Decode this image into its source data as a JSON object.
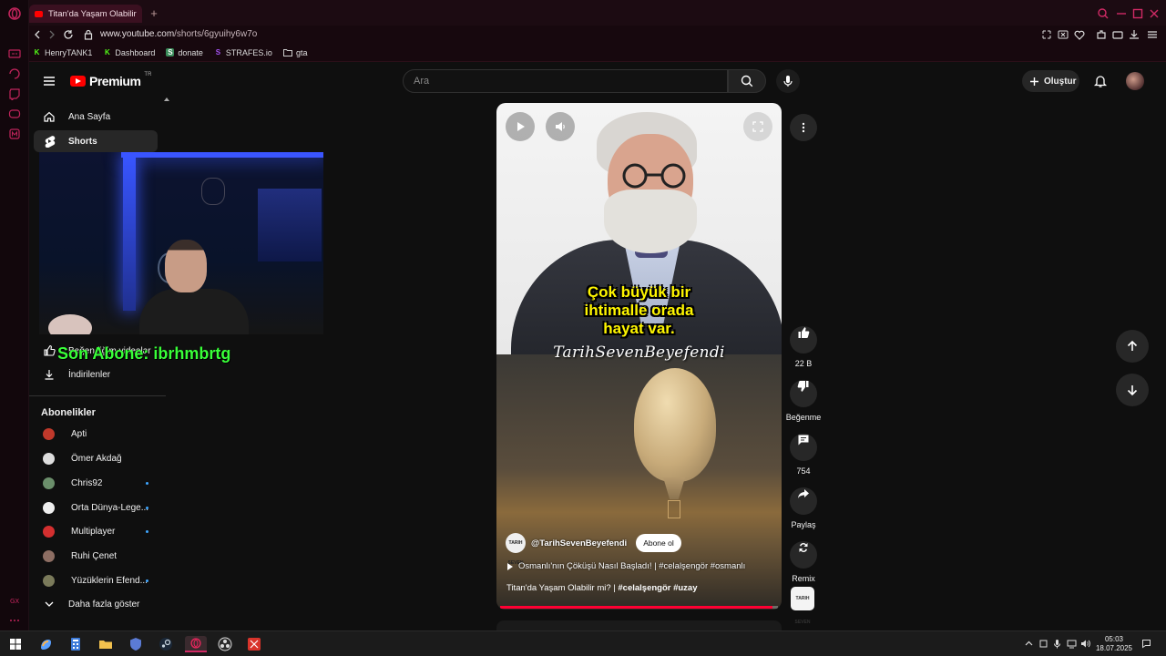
{
  "browser": {
    "tab_title": "Titan'da Yaşam Olabilir mi",
    "url_host": "www.youtube.com",
    "url_path": "/shorts/6gyuihy6w7o",
    "bookmarks": [
      {
        "label": "HenryTANK1",
        "icon": "K",
        "color": "#53fc18"
      },
      {
        "label": "Dashboard",
        "icon": "K",
        "color": "#53fc18"
      },
      {
        "label": "donate",
        "icon": "S",
        "color": "#3a8c5a"
      },
      {
        "label": "STRAFES.io",
        "icon": "S",
        "color": "#a855f7"
      },
      {
        "label": "gta",
        "icon": "folder",
        "color": "#cccccc"
      }
    ],
    "accent_color": "#d02a65"
  },
  "masthead": {
    "logo_text": "Premium",
    "logo_region": "TR",
    "search_placeholder": "Ara",
    "create_label": "Oluştur"
  },
  "sidebar": {
    "items": [
      {
        "label": "Ana Sayfa",
        "icon": "home-icon",
        "active": false
      },
      {
        "label": "Shorts",
        "icon": "shorts-icon",
        "active": true
      },
      {
        "label": "Beğendiğim videolar",
        "icon": "like-icon",
        "active": false
      },
      {
        "label": "İndirilenler",
        "icon": "download-icon",
        "active": false
      }
    ],
    "subscriptions_title": "Abonelikler",
    "subscriptions": [
      {
        "name": "Apti",
        "color": "#c0392b",
        "new": false
      },
      {
        "name": "Ömer Akdağ",
        "color": "#dddddd",
        "new": false
      },
      {
        "name": "Chris92",
        "color": "#6b8f6b",
        "new": true
      },
      {
        "name": "Orta Dünya-Lege...",
        "color": "#eeeeee",
        "new": true
      },
      {
        "name": "Multiplayer",
        "color": "#d32f2f",
        "new": true
      },
      {
        "name": "Ruhi Çenet",
        "color": "#8d6e63",
        "new": false
      },
      {
        "name": "Yüzüklerin Efend...",
        "color": "#7a7a5a",
        "new": true
      }
    ],
    "show_more_label": "Daha fazla göster"
  },
  "overlay": {
    "last_subscriber": "Son Abone: ibrhmbrtg"
  },
  "short": {
    "caption": "Çok büyük bir ihtimalle orada hayat var.",
    "caption_lines": [
      "Çok büyük bir",
      "ihtimalle orada",
      "hayat var."
    ],
    "watermark": "TarihSevenBeyefendi",
    "channel_handle": "@TarihSevenBeyefendi",
    "channel_avatar_text": "TARIH SEVEN",
    "subscribe_label": "Abone ol",
    "playlist_text": "Osmanlı'nın Çöküşü Nasıl Başladı! | #celalşengör #osmanlı",
    "title_plain": "Titan'da Yaşam Olabilir mi? | ",
    "title_tags": "#celalşengör #uzay",
    "progress_fraction": 0.98
  },
  "actions": {
    "likes": "22 B",
    "dislike_label": "Beğenme",
    "comments": "754",
    "share_label": "Paylaş",
    "remix_label": "Remix"
  },
  "taskbar": {
    "time": "05:03",
    "date": "18.07.2025"
  }
}
